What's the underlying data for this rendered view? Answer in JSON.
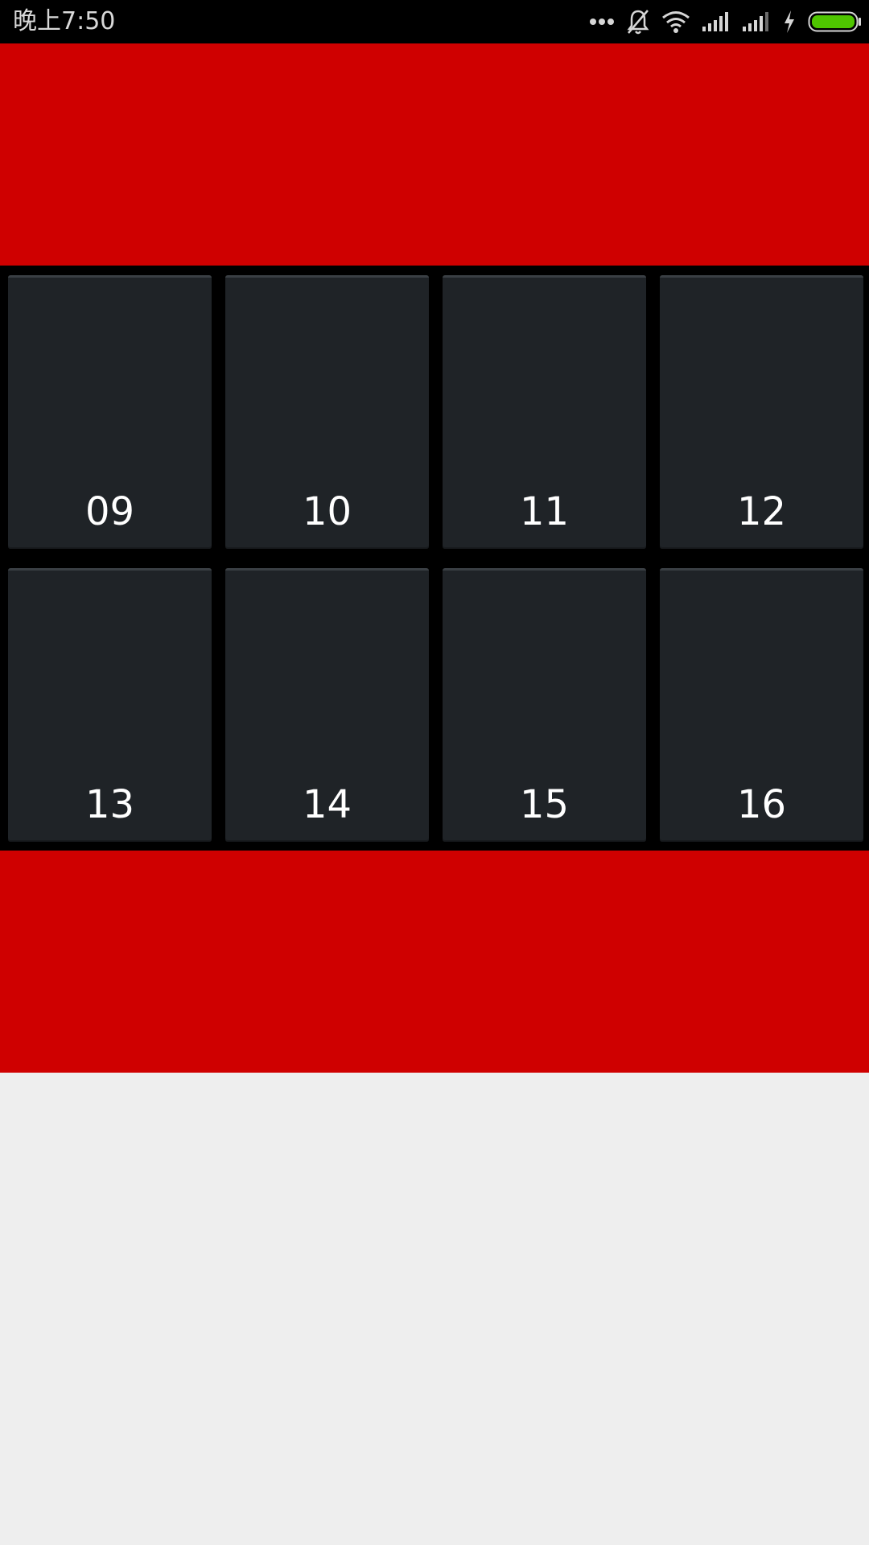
{
  "status_bar": {
    "time": "晚上7:50",
    "icons": [
      "more-dots-icon",
      "bell-muted-icon",
      "wifi-icon",
      "signal-icon",
      "signal-icon",
      "charging-icon",
      "battery-icon"
    ],
    "battery_color": "#4fc600"
  },
  "colors": {
    "red_band": "#cf0000",
    "tile": "#1f2327",
    "grid_bg": "#000000",
    "page_bg": "#eeeeee"
  },
  "tiles": [
    {
      "label": "09"
    },
    {
      "label": "10"
    },
    {
      "label": "11"
    },
    {
      "label": "12"
    },
    {
      "label": "13"
    },
    {
      "label": "14"
    },
    {
      "label": "15"
    },
    {
      "label": "16"
    }
  ]
}
